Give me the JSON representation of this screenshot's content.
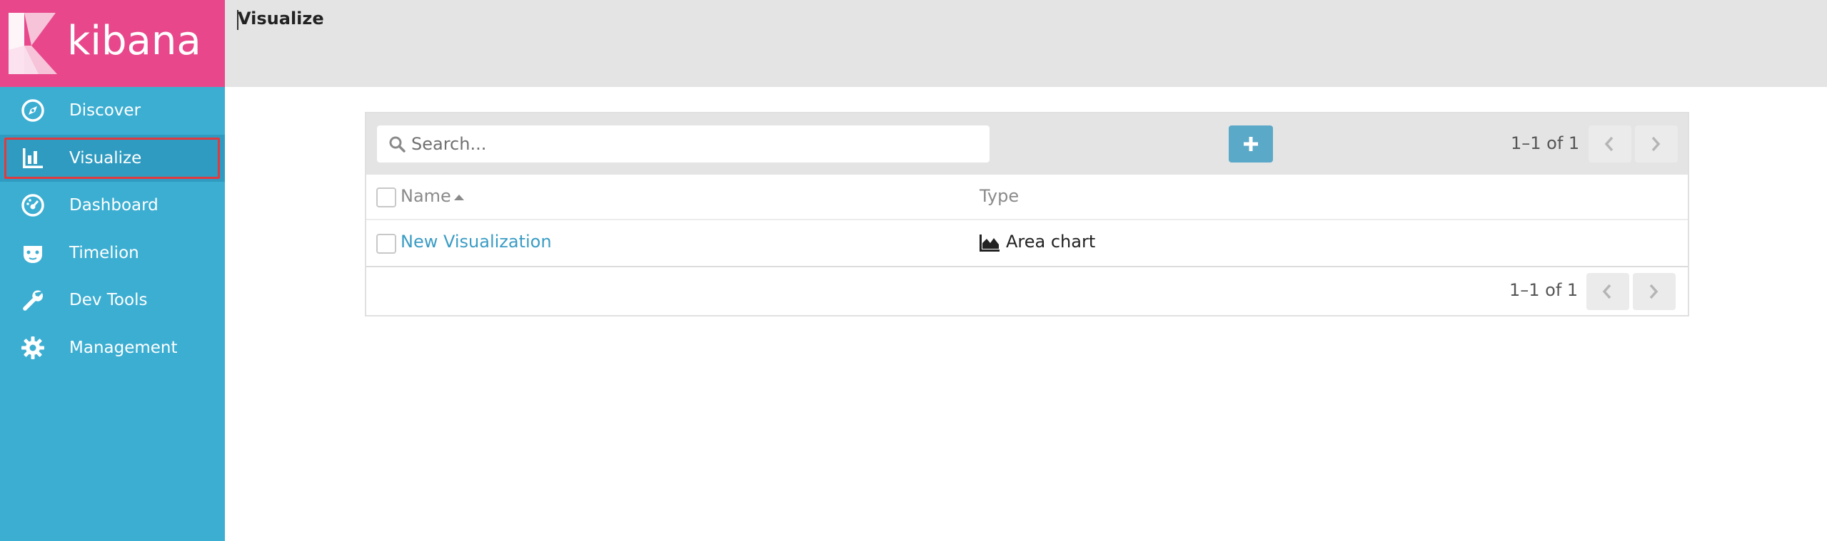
{
  "brand": {
    "name": "kibana"
  },
  "sidebar": {
    "items": [
      {
        "label": "Discover",
        "icon": "compass-icon"
      },
      {
        "label": "Visualize",
        "icon": "bar-chart-icon",
        "active": true
      },
      {
        "label": "Dashboard",
        "icon": "dashboard-gauge-icon"
      },
      {
        "label": "Timelion",
        "icon": "timelion-mask-icon"
      },
      {
        "label": "Dev Tools",
        "icon": "wrench-icon"
      },
      {
        "label": "Management",
        "icon": "gear-icon"
      }
    ]
  },
  "header": {
    "title": "Visualize"
  },
  "toolbar": {
    "search_placeholder": "Search...",
    "add_button_icon": "plus-icon",
    "pager_text": "1–1 of 1"
  },
  "table": {
    "columns": [
      "Name",
      "Type"
    ],
    "rows": [
      {
        "name": "New Visualization",
        "type": "Area chart",
        "type_icon": "area-chart-icon"
      }
    ]
  },
  "footer": {
    "pager_text": "1–1 of 1"
  },
  "colors": {
    "sidebar": "#3caed2",
    "logo_bg": "#e8488b",
    "link": "#3a9cc4",
    "add_button": "#5ba9c8",
    "highlight": "#e0393e"
  }
}
